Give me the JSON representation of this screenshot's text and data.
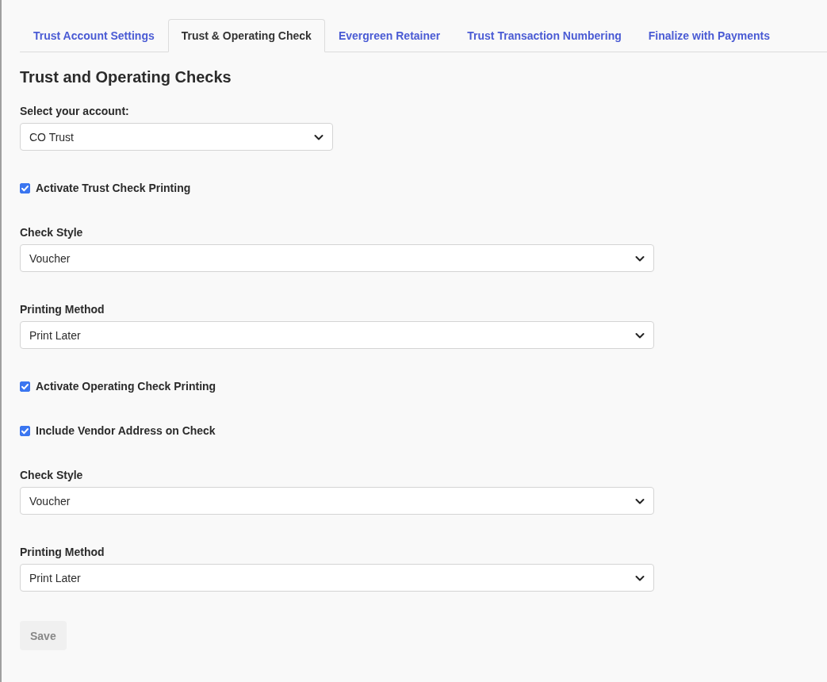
{
  "tabs": [
    {
      "label": "Trust Account Settings",
      "selected": false
    },
    {
      "label": "Trust & Operating Check",
      "selected": true
    },
    {
      "label": "Evergreen Retainer",
      "selected": false
    },
    {
      "label": "Trust Transaction Numbering",
      "selected": false
    },
    {
      "label": "Finalize with Payments",
      "selected": false
    }
  ],
  "heading": "Trust and Operating Checks",
  "fields": [
    {
      "kind": "account_select",
      "label": "Select your account:",
      "value": "CO Trust"
    },
    {
      "kind": "checkbox",
      "label": "Activate Trust Check Printing",
      "checked": true
    },
    {
      "kind": "select",
      "label": "Check Style",
      "value": "Voucher"
    },
    {
      "kind": "select",
      "label": "Printing Method",
      "value": "Print Later"
    },
    {
      "kind": "checkbox",
      "label": "Activate Operating Check Printing",
      "checked": true
    },
    {
      "kind": "checkbox",
      "label": "Include Vendor Address on Check",
      "checked": true
    },
    {
      "kind": "select",
      "label": "Check Style",
      "value": "Voucher"
    },
    {
      "kind": "select",
      "label": "Printing Method",
      "value": "Print Later"
    }
  ],
  "save_button": {
    "label": "Save",
    "disabled": true
  }
}
